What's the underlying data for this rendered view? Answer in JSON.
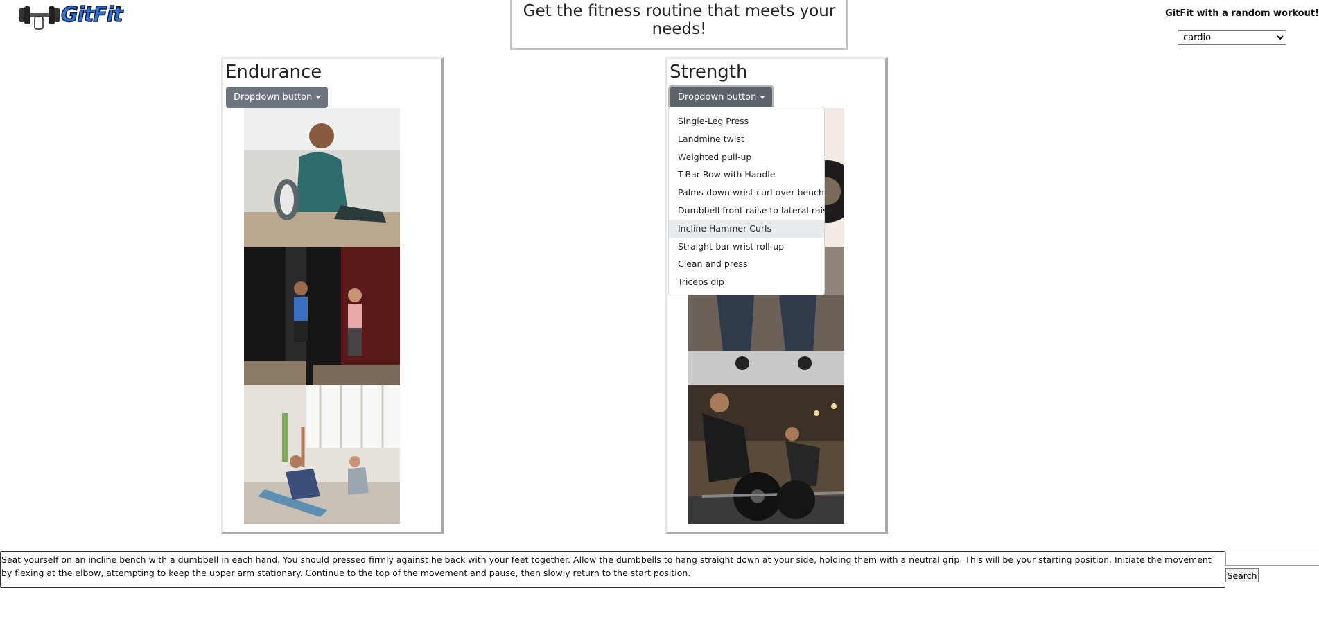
{
  "header": {
    "logo_text": "GitFit",
    "headline": "Get the fitness routine that meets your needs!",
    "random_link": "GitFit with a random workout!",
    "random_select_value": "cardio"
  },
  "cards": {
    "endurance": {
      "title": "Endurance",
      "dropdown_label": "Dropdown button"
    },
    "strength": {
      "title": "Strength",
      "dropdown_label": "Dropdown button",
      "menu_items": [
        "Single-Leg Press",
        "Landmine twist",
        "Weighted pull-up",
        "T-Bar Row with Handle",
        "Palms-down wrist curl over bench",
        "Dumbbell front raise to lateral raise",
        "Incline Hammer Curls",
        "Straight-bar wrist roll-up",
        "Clean and press",
        "Triceps dip"
      ],
      "active_item": "Incline Hammer Curls"
    }
  },
  "description": "Seat yourself on an incline bench with a dumbbell in each hand. You should pressed firmly against he back with your feet together. Allow the dumbbells to hang straight down at your side, holding them with a neutral grip. This will be your starting position. Initiate the movement by flexing at the elbow, attempting to keep the upper arm stationary. Continue to the top of the movement and pause, then slowly return to the start position.",
  "search": {
    "input_value": "",
    "button_label": "Search"
  },
  "colors": {
    "dropdown_button": "#6c757d",
    "logo": "#2a6ed6"
  }
}
